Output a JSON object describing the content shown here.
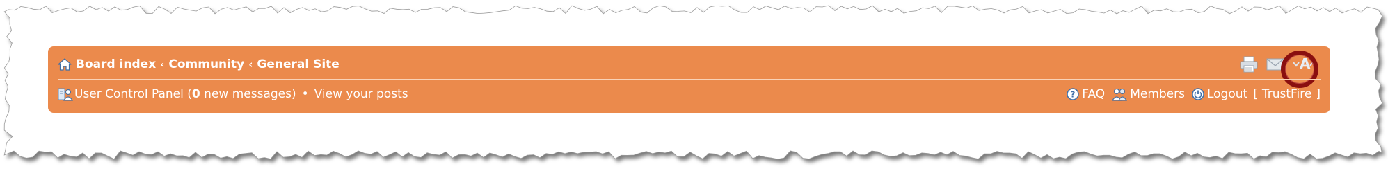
{
  "breadcrumbs": [
    {
      "label": "Board index"
    },
    {
      "label": "Community"
    },
    {
      "label": "General Site"
    }
  ],
  "user_bar": {
    "ucp_label": "User Control Panel",
    "messages_open": " (",
    "messages_count": "0",
    "messages_text": " new messages)",
    "bullet": "•",
    "view_posts": "View your posts"
  },
  "right_links": {
    "faq": "FAQ",
    "members": "Members",
    "logout": "Logout",
    "username_open": "[",
    "username": "TrustFire",
    "username_close": "]"
  },
  "tools": {
    "icons": [
      "print-icon",
      "email-icon",
      "font-size-icon"
    ],
    "font_size_glyph": "A"
  },
  "colors": {
    "navbar": "#eb8a4c",
    "highlight_ring": "#8a0f0f",
    "text": "#ffffff"
  }
}
